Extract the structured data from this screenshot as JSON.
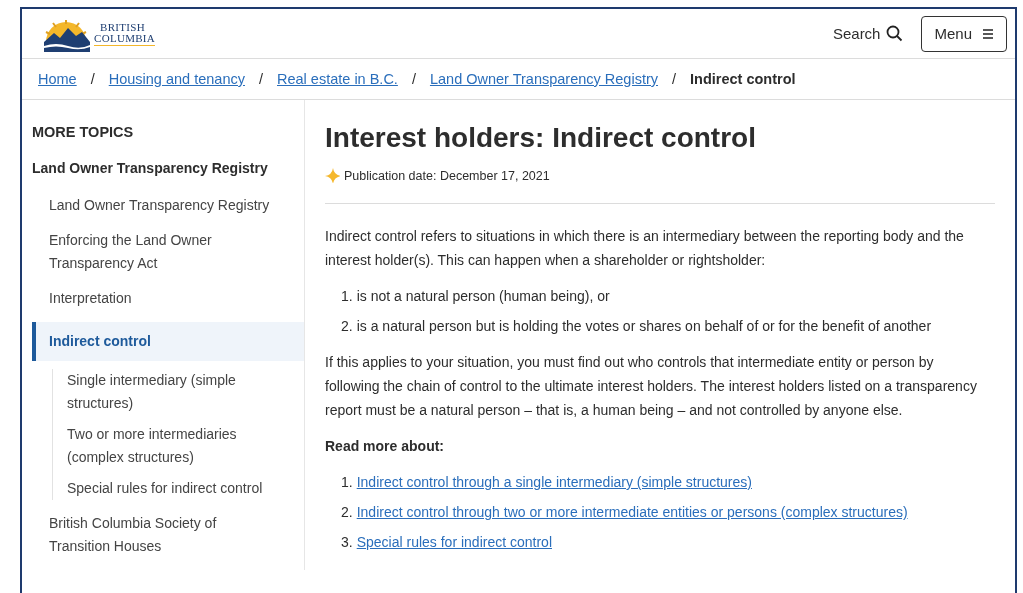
{
  "header": {
    "logo_text": [
      "BRITISH",
      "COLUMBIA"
    ],
    "search_label": "Search",
    "menu_label": "Menu"
  },
  "breadcrumb": {
    "separator": "/",
    "items": [
      {
        "label": "Home",
        "kind": "link"
      },
      {
        "label": "Housing and tenancy",
        "kind": "link"
      },
      {
        "label": "Real estate in B.C.",
        "kind": "link"
      },
      {
        "label": "Land Owner Transparency Registry",
        "kind": "link"
      },
      {
        "label": "Indirect control",
        "kind": "current"
      }
    ]
  },
  "sidebar": {
    "heading": "MORE TOPICS",
    "section": "Land Owner Transparency Registry",
    "items": [
      {
        "label": "Land Owner Transparency Registry",
        "selected": false
      },
      {
        "label": "Enforcing the Land Owner Transparency Act",
        "selected": false
      },
      {
        "label": "Interpretation",
        "selected": false
      },
      {
        "label": "Indirect control",
        "selected": true,
        "children": [
          {
            "label": "Single intermediary (simple structures)",
            "selected": false
          },
          {
            "label": "Two or more intermediaries (complex structures)",
            "selected": false
          },
          {
            "label": "Special rules for indirect control",
            "selected": false
          }
        ]
      },
      {
        "label": "British Columbia Society of Transition Houses",
        "selected": false
      }
    ]
  },
  "main": {
    "title": "Interest holders: Indirect control",
    "publication_date": "Publication date: December 17, 2021",
    "blocks": [
      {
        "kind": "paragraph",
        "text": "Indirect control refers to situations in which there is an intermediary between the reporting body and the interest holder(s). This can happen when a shareholder or rightsholder:"
      },
      {
        "kind": "list",
        "items": [
          {
            "number": "1.",
            "text": "is not a natural person (human being), or"
          },
          {
            "number": "2.",
            "text": "is a natural person but is holding the votes or shares on behalf of or for the benefit of another"
          }
        ]
      },
      {
        "kind": "paragraph",
        "text": "If this applies to your situation, you must find out who controls that intermediate entity or person by following the chain of control to the ultimate interest holders. The interest holders listed on a transparency report must be a natural person – that is, a human being – and not controlled by anyone else."
      },
      {
        "kind": "heading",
        "text": "Read more about:"
      },
      {
        "kind": "links",
        "items": [
          {
            "number": "1.",
            "text": "Indirect control through a single intermediary (simple structures)"
          },
          {
            "number": "2.",
            "text": "Indirect control through two or more intermediate entities or persons (complex structures)"
          },
          {
            "number": "3.",
            "text": "Special rules for indirect control"
          }
        ]
      }
    ]
  }
}
